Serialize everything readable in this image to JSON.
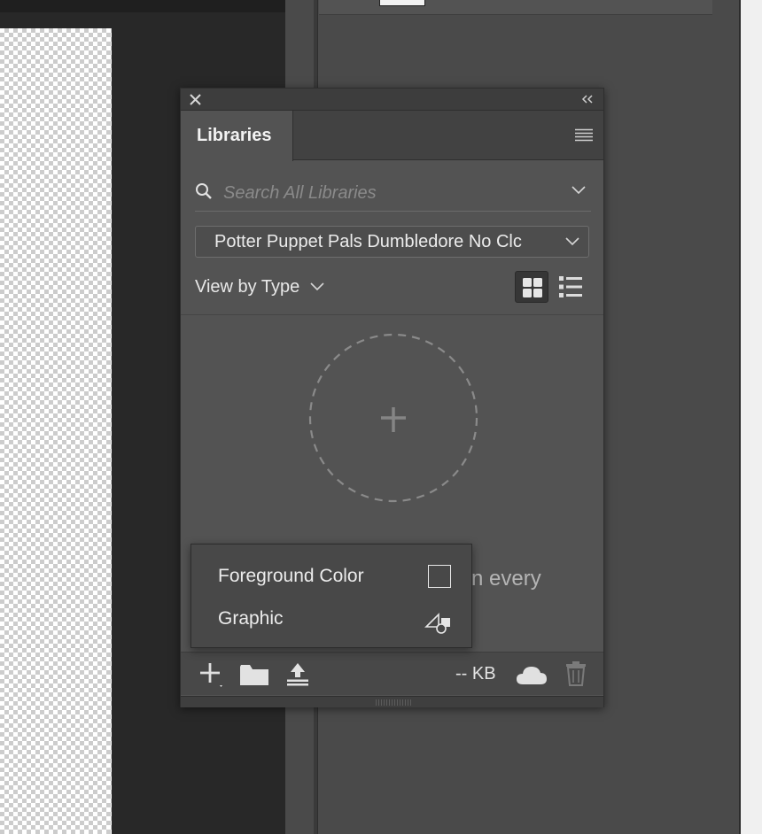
{
  "libraries_panel": {
    "tab_label": "Libraries",
    "search": {
      "placeholder": "Search All Libraries",
      "value": ""
    },
    "selected_library": "Potter Puppet Pals Dumbledore No Clc",
    "view_by": "View by Type",
    "view_mode": "grid",
    "background_text": "n every",
    "add_menu": [
      {
        "label": "Foreground Color",
        "icon": "color-swatch-icon"
      },
      {
        "label": "Graphic",
        "icon": "graphic-shapes-icon"
      }
    ],
    "footer": {
      "storage": "-- KB"
    }
  },
  "colors": {
    "panel": "#535353",
    "text": "#ececec",
    "canvas": "#282828"
  }
}
